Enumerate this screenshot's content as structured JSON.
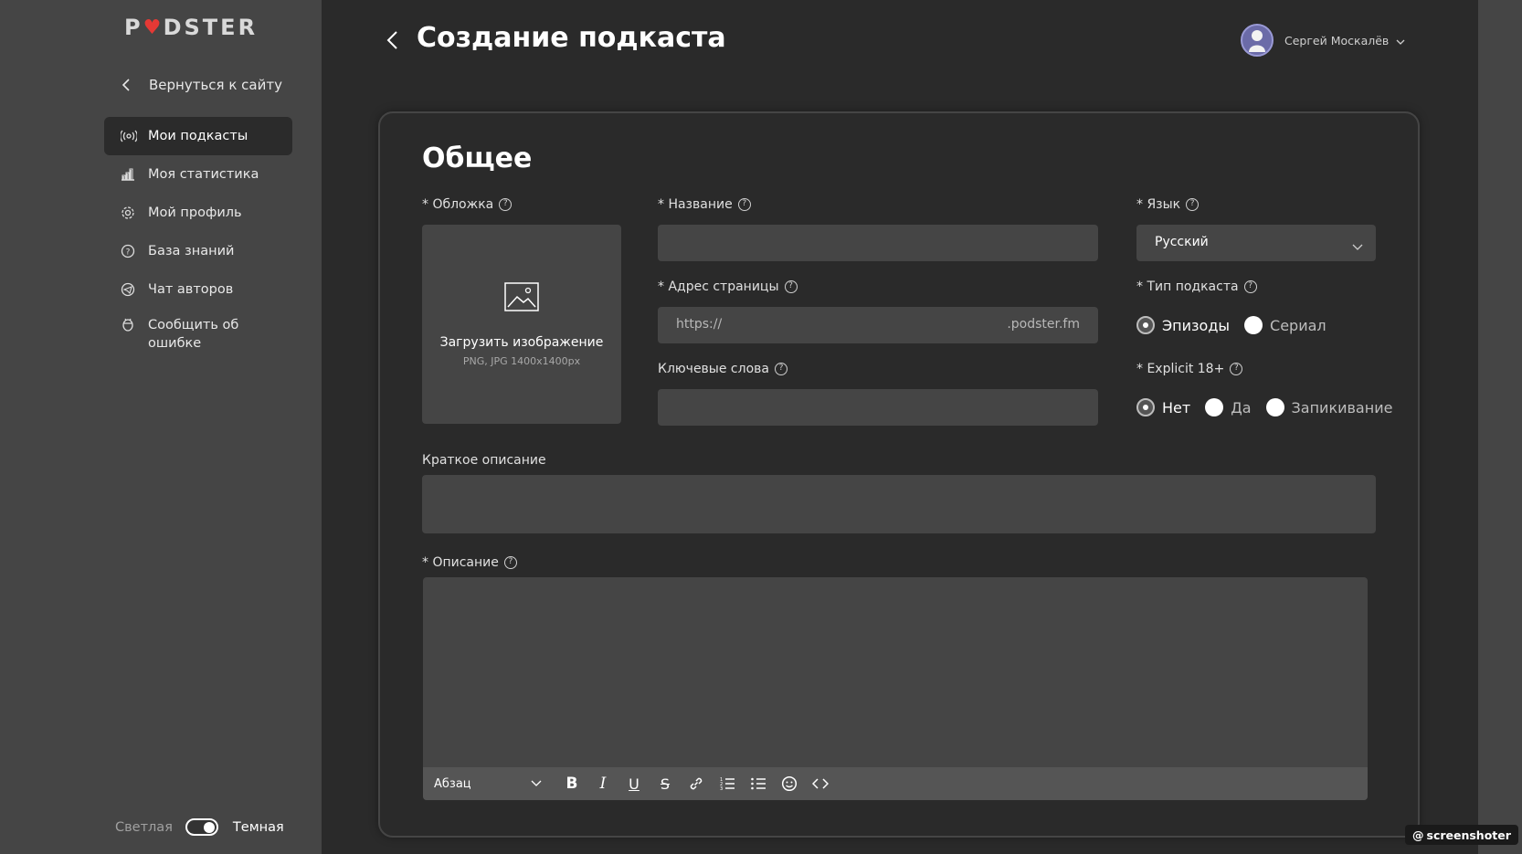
{
  "sidebar": {
    "logo": {
      "left": "P",
      "right": "DSTER"
    },
    "back_link": "Вернуться к сайту",
    "items": [
      {
        "label": "Мои подкасты",
        "icon": "broadcast-icon"
      },
      {
        "label": "Моя статистика",
        "icon": "bar-chart-icon"
      },
      {
        "label": "Мой профиль",
        "icon": "gear-icon"
      },
      {
        "label": "База знаний",
        "icon": "question-circle-icon"
      },
      {
        "label": "Чат авторов",
        "icon": "telegram-icon"
      },
      {
        "label": "Сообщить об ошибке",
        "icon": "bug-icon"
      }
    ],
    "theme": {
      "light": "Светлая",
      "dark": "Темная"
    }
  },
  "header": {
    "title": "Создание подкаста",
    "user_name": "Сергей Москалёв"
  },
  "form": {
    "section_title": "Общее",
    "cover": {
      "label": "* Обложка",
      "upload_text": "Загрузить изображение",
      "upload_hint": "PNG, JPG 1400x1400px"
    },
    "name": {
      "label": "* Название",
      "value": ""
    },
    "address": {
      "label": "* Адрес страницы",
      "prefix": "https://",
      "suffix": ".podster.fm"
    },
    "keywords": {
      "label": "Ключевые слова",
      "value": ""
    },
    "language": {
      "label": "* Язык",
      "value": "Русский"
    },
    "podcast_type": {
      "label": "* Тип подкаста",
      "options": [
        "Эпизоды",
        "Сериал"
      ],
      "selected": "Эпизоды"
    },
    "explicit": {
      "label": "* Explicit 18+",
      "options": [
        "Нет",
        "Да",
        "Запикивание"
      ],
      "selected": "Нет"
    },
    "short_description": {
      "label": "Краткое описание",
      "value": ""
    },
    "description": {
      "label": "* Описание",
      "value": ""
    },
    "editor_toolbar": {
      "format": "Абзац",
      "buttons": [
        "bold",
        "italic",
        "underline",
        "strikethrough",
        "link",
        "ordered-list",
        "bullet-list",
        "emoji",
        "code"
      ]
    }
  },
  "watermark": "screenshoter",
  "colors": {
    "sidebar_bg": "#454545",
    "main_bg": "#2a2a2a",
    "input_bg": "#454545",
    "logo_heart": "#e53935"
  }
}
